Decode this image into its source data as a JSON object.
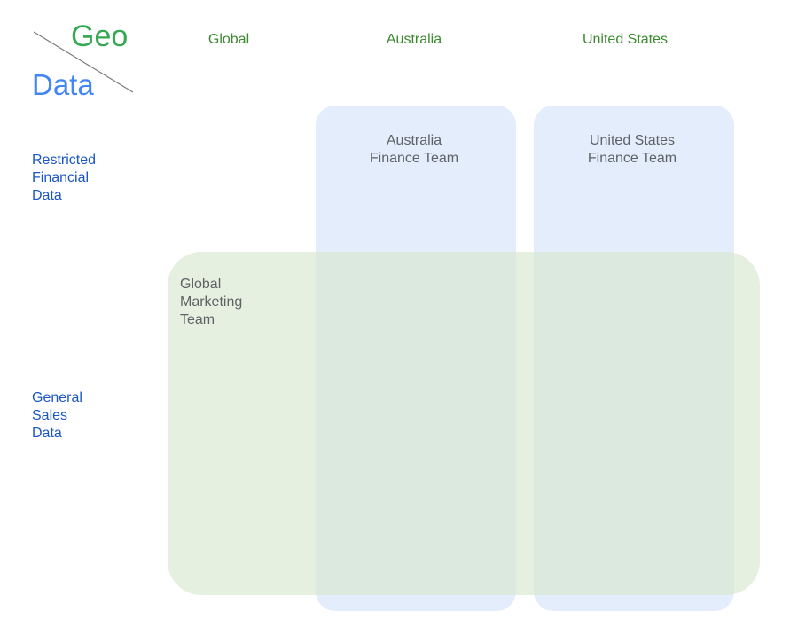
{
  "corner": {
    "geo_label": "Geo",
    "data_label": "Data"
  },
  "columns": [
    "Global",
    "Australia",
    "United States"
  ],
  "rows": [
    "Restricted\nFinancial\nData",
    "General\nSales\nData"
  ],
  "teams": {
    "global_marketing": "Global\nMarketing\nTeam",
    "australia_finance": "Australia\nFinance Team",
    "us_finance": "United States\nFinance Team"
  },
  "colors": {
    "geo_green": "#34a853",
    "header_green": "#3a8a2f",
    "data_blue": "#4285f4",
    "row_blue": "#1a56c4",
    "team_text": "#5f6368",
    "blue_region": "#dbe7fb",
    "green_region": "#e4eedd"
  }
}
